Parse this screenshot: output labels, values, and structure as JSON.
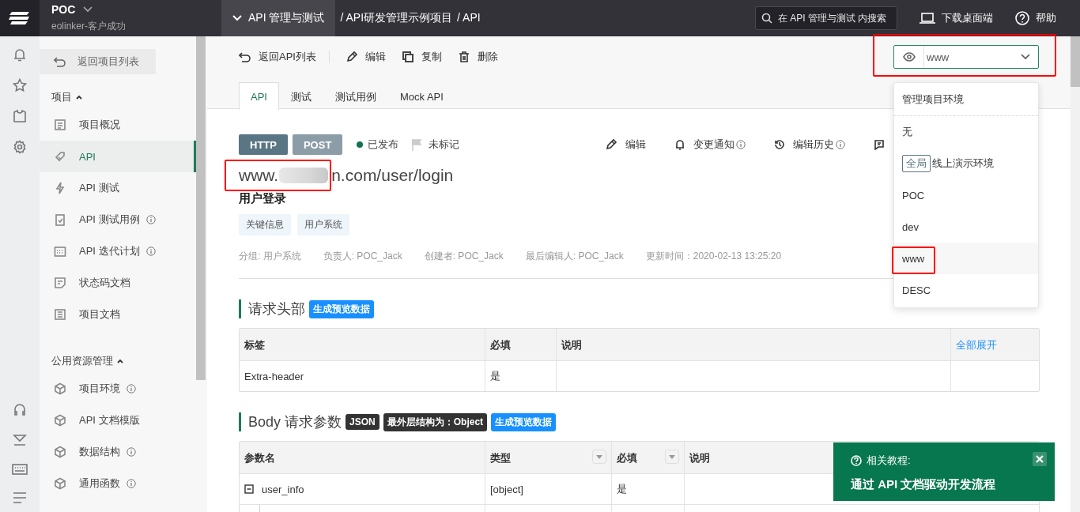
{
  "topbar": {
    "project": "POC",
    "subtitle": "eolinker-客户成功",
    "module": "API 管理与测试",
    "breadcrumb": [
      "/ API研发管理示例项目",
      "/ API"
    ],
    "search": {
      "placeholder": "在 API 管理与测试 内搜索"
    },
    "download": "下载桌面端",
    "help": "帮助"
  },
  "sidebar": {
    "back": "返回项目列表",
    "groups": [
      {
        "title": "项目",
        "expanded": true,
        "items": [
          {
            "label": "项目概况",
            "selected": false,
            "info": false
          },
          {
            "label": "API",
            "selected": true,
            "info": false
          },
          {
            "label": "API 测试",
            "selected": false,
            "info": false
          },
          {
            "label": "API 测试用例",
            "selected": false,
            "info": true
          },
          {
            "label": "API 迭代计划",
            "selected": false,
            "info": true
          },
          {
            "label": "状态码文档",
            "selected": false,
            "info": false
          },
          {
            "label": "项目文档",
            "selected": false,
            "info": false
          }
        ]
      },
      {
        "title": "公用资源管理",
        "expanded": true,
        "items": [
          {
            "label": "项目环境",
            "selected": false,
            "info": true
          },
          {
            "label": "API 文档模版",
            "selected": false,
            "info": false
          },
          {
            "label": "数据结构",
            "selected": false,
            "info": true
          },
          {
            "label": "通用函数",
            "selected": false,
            "info": true
          }
        ]
      }
    ]
  },
  "toolbar": [
    "返回API列表",
    "编辑",
    "复制",
    "删除"
  ],
  "env_select": {
    "value": "www",
    "header": "管理项目环境",
    "options": [
      {
        "label": "无",
        "selected": false
      },
      {
        "label": "线上演示环境",
        "tag": "全局",
        "selected": false
      },
      {
        "label": "POC",
        "selected": false
      },
      {
        "label": "dev",
        "selected": false
      },
      {
        "label": "www",
        "selected": true
      },
      {
        "label": "DESC",
        "selected": false
      }
    ]
  },
  "tabs": [
    {
      "label": "API",
      "selected": true
    },
    {
      "label": "测试",
      "selected": false
    },
    {
      "label": "测试用例",
      "selected": false
    },
    {
      "label": "Mock API",
      "selected": false
    }
  ],
  "api": {
    "protocol": "HTTP",
    "method": "POST",
    "status": "已发布",
    "mark": "未标记",
    "actions": [
      {
        "label": "编辑",
        "info": false
      },
      {
        "label": "变更通知",
        "info": true
      },
      {
        "label": "编辑历史",
        "info": true
      }
    ],
    "url_start": "www.",
    "url_end": "n.com/user/login",
    "name": "用户登录",
    "tags": [
      "关键信息",
      "用户系统"
    ],
    "meta": [
      "分组: 用户系统",
      "负责人: POC_Jack",
      "创建者: POC_Jack",
      "最后编辑人: POC_Jack",
      "更新时间：2020-02-13 13:25:20"
    ]
  },
  "sections": [
    {
      "title": "请求头部",
      "badges": [
        {
          "label": "生成预览数据",
          "kind": "action"
        }
      ],
      "columns": [
        {
          "label": "标签",
          "filter": false
        },
        {
          "label": "必填",
          "filter": false
        },
        {
          "label": "说明",
          "filter": false
        },
        {
          "label": "全部展开",
          "filter": false,
          "kind": "link"
        }
      ],
      "rows": [
        {
          "cells": [
            "Extra-header",
            "是",
            "",
            ""
          ]
        }
      ]
    },
    {
      "title": "Body 请求参数",
      "badges": [
        {
          "label": "JSON",
          "kind": "info"
        },
        {
          "label": "最外层结构为：Object",
          "kind": "info"
        },
        {
          "label": "生成预览数据",
          "kind": "action"
        }
      ],
      "columns": [
        {
          "label": "参数名",
          "filter": false
        },
        {
          "label": "类型",
          "filter": true
        },
        {
          "label": "必填",
          "filter": true
        },
        {
          "label": "说明",
          "filter": false
        }
      ],
      "rows": [
        {
          "cells": [
            "user_info",
            "[object]",
            "是",
            ""
          ],
          "expanded": true
        },
        {
          "cells": [
            "",
            "",
            "",
            ""
          ],
          "child": true
        }
      ]
    }
  ],
  "toast": {
    "title": "相关教程:",
    "link": "通过 API 文档驱动开发流程"
  }
}
